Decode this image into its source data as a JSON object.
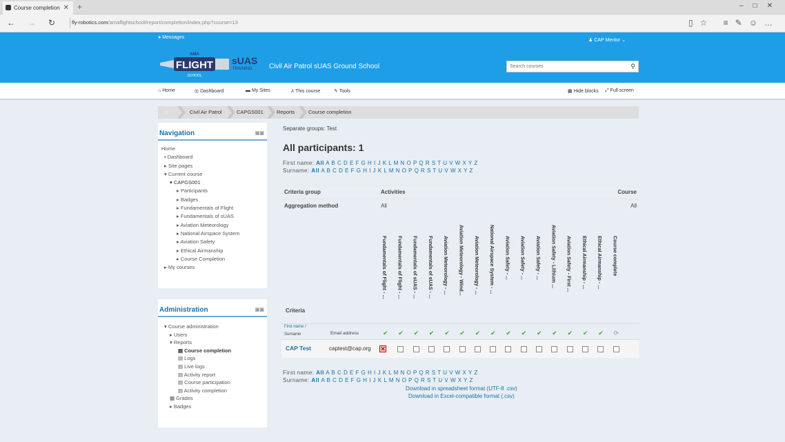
{
  "browser": {
    "tab_title": "Course completion",
    "url_host": "fly-robotics.com",
    "url_path": "/amaflightschool/report/completion/index.php?course=13"
  },
  "header": {
    "messages": "Messages",
    "user": "CAP Mentor",
    "site_name": "Civil Air Patrol sUAS Ground School",
    "search_placeholder": "Search courses",
    "logo_flight": "FLIGHT",
    "logo_ama": "AMA",
    "logo_school": "SCHOOL",
    "logo_suas": "sUAS",
    "logo_training": "TRAINING"
  },
  "menu": {
    "home": "Home",
    "dashboard": "Dashboard",
    "my_sites": "My Sites",
    "this_course": "This course",
    "tools": "Tools",
    "hide_blocks": "Hide blocks",
    "full_screen": "Full screen"
  },
  "breadcrumb": [
    "Civil Air Patrol",
    "CAPGS001",
    "Reports",
    "Course completion"
  ],
  "navigation": {
    "title": "Navigation",
    "items": [
      "Home",
      "Dashboard",
      "Site pages",
      "Current course",
      "CAPGS001",
      "Participants",
      "Badges",
      "Fundamentals of Flight",
      "Fundamentals of sUAS",
      "Aviation Meteorology",
      "National Airspace System",
      "Aviation Safety",
      "Ethical Airmanship",
      "Course Completion",
      "My courses"
    ]
  },
  "administration": {
    "title": "Administration",
    "items": [
      "Course administration",
      "Users",
      "Reports",
      "Course completion",
      "Logs",
      "Live logs",
      "Activity report",
      "Course participation",
      "Activity completion",
      "Grades",
      "Badges"
    ]
  },
  "report": {
    "separate_groups": "Separate groups: Test",
    "heading": "All participants: 1",
    "firstname_label": "First name:",
    "surname_label": "Surname:",
    "all": "All",
    "letters": "A B C D E F G H I J K L M N O P Q R S T U V W X Y Z",
    "criteria_group": "Criteria group",
    "activities": "Activities",
    "course": "Course",
    "aggregation_method": "Aggregation method",
    "agg_activities": "All",
    "agg_course": "All",
    "criteria": "Criteria",
    "columns": [
      "Fundamentals of Flight - ...",
      "Fundamentals of Flight - ...",
      "Fundamentals of sUAS - ...",
      "Fundamentals of sUAS - ...",
      "Aviation Meteorology - ...",
      "Aviation Meteorology - Wind...",
      "Aviation Meteorology - ...",
      "National Airspace System - ...",
      "Aviation Safety - ...",
      "Aviation Safety - ...",
      "Aviation Safety - ...",
      "Aviation Safety - Lithium ...",
      "Aviation Safety - First ...",
      "Ethical Airmanship - ...",
      "Ethical Airmanship - ...",
      "Course complete"
    ],
    "first_name_surname": "First name /",
    "surname": "Surname",
    "email_header": "Email address",
    "participant_name": "CAP Test",
    "participant_email": "captest@cap.org",
    "download_ods": "Download in spreadsheet format (UTF-8 .csv)",
    "download_csv": "Download in Excel-compatible format (.csv)"
  }
}
